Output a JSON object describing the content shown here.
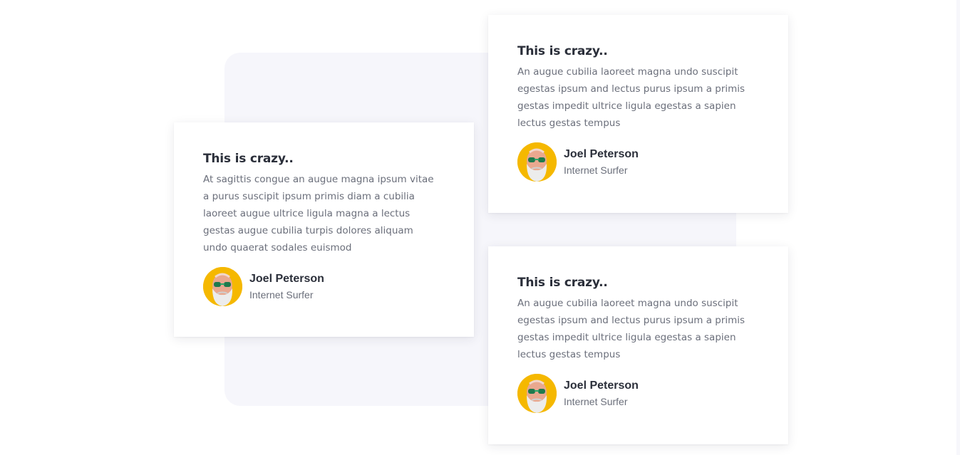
{
  "testimonials": [
    {
      "title": "This is crazy..",
      "text": "At sagittis congue an augue magna ipsum vitae a purus suscipit ipsum primis diam a cubilia laoreet augue ultrice ligula magna a lectus gestas augue cubilia turpis dolores aliquam undo quaerat sodales euismod",
      "author": "Joel Peterson",
      "role": "Internet Surfer",
      "avatar_icon": "bearded-man-sunglasses-avatar"
    },
    {
      "title": "This is crazy..",
      "text": "An augue cubilia laoreet magna undo suscipit egestas ipsum and lectus purus ipsum a primis gestas impedit ultrice ligula egestas a sapien lectus gestas tempus",
      "author": "Joel Peterson",
      "role": "Internet Surfer",
      "avatar_icon": "bearded-man-sunglasses-avatar"
    },
    {
      "title": "This is crazy..",
      "text": "An augue cubilia laoreet magna undo suscipit egestas ipsum and lectus purus ipsum a primis gestas impedit ultrice ligula egestas a sapien lectus gestas tempus",
      "author": "Joel Peterson",
      "role": "Internet Surfer",
      "avatar_icon": "bearded-man-sunglasses-avatar"
    }
  ],
  "colors": {
    "page_background": "#ffffff",
    "panel_background": "#f6f6fb",
    "card_background": "#ffffff",
    "title_color": "#2b2f3a",
    "text_color": "#6b6f7b",
    "avatar_background": "#f5b800"
  }
}
